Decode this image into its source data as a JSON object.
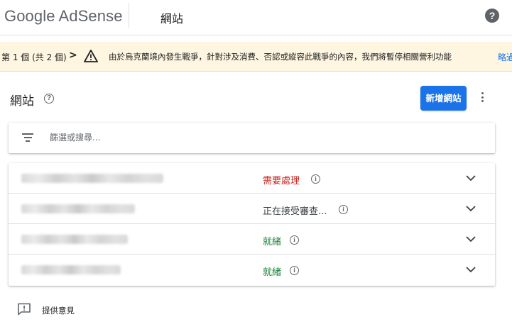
{
  "header": {
    "logo_text": "Google AdSense",
    "page_title": "網站",
    "help_icon": "help-circle-icon",
    "help_glyph": "?"
  },
  "banner": {
    "count": "第 1 個 (共 2 個)",
    "next_glyph": ">",
    "message": "由於烏克蘭境內發生戰爭，針對涉及消費、否認或縱容此戰爭的內容，我們將暫停相關營利功能",
    "link": "略過",
    "background": "#fef6e0"
  },
  "section": {
    "title": "網站",
    "add_button": "新增網站",
    "accent": "#1a73e8"
  },
  "filter": {
    "placeholder": "篩選或搜尋..."
  },
  "sites": [
    {
      "status": "需要處理",
      "status_color": "#c5221f"
    },
    {
      "status": "正在接受審查...",
      "status_color": "#3c4043"
    },
    {
      "status": "就緒",
      "status_color": "#188038"
    },
    {
      "status": "就緒",
      "status_color": "#188038"
    }
  ],
  "footer": {
    "feedback_label": "提供意見"
  }
}
